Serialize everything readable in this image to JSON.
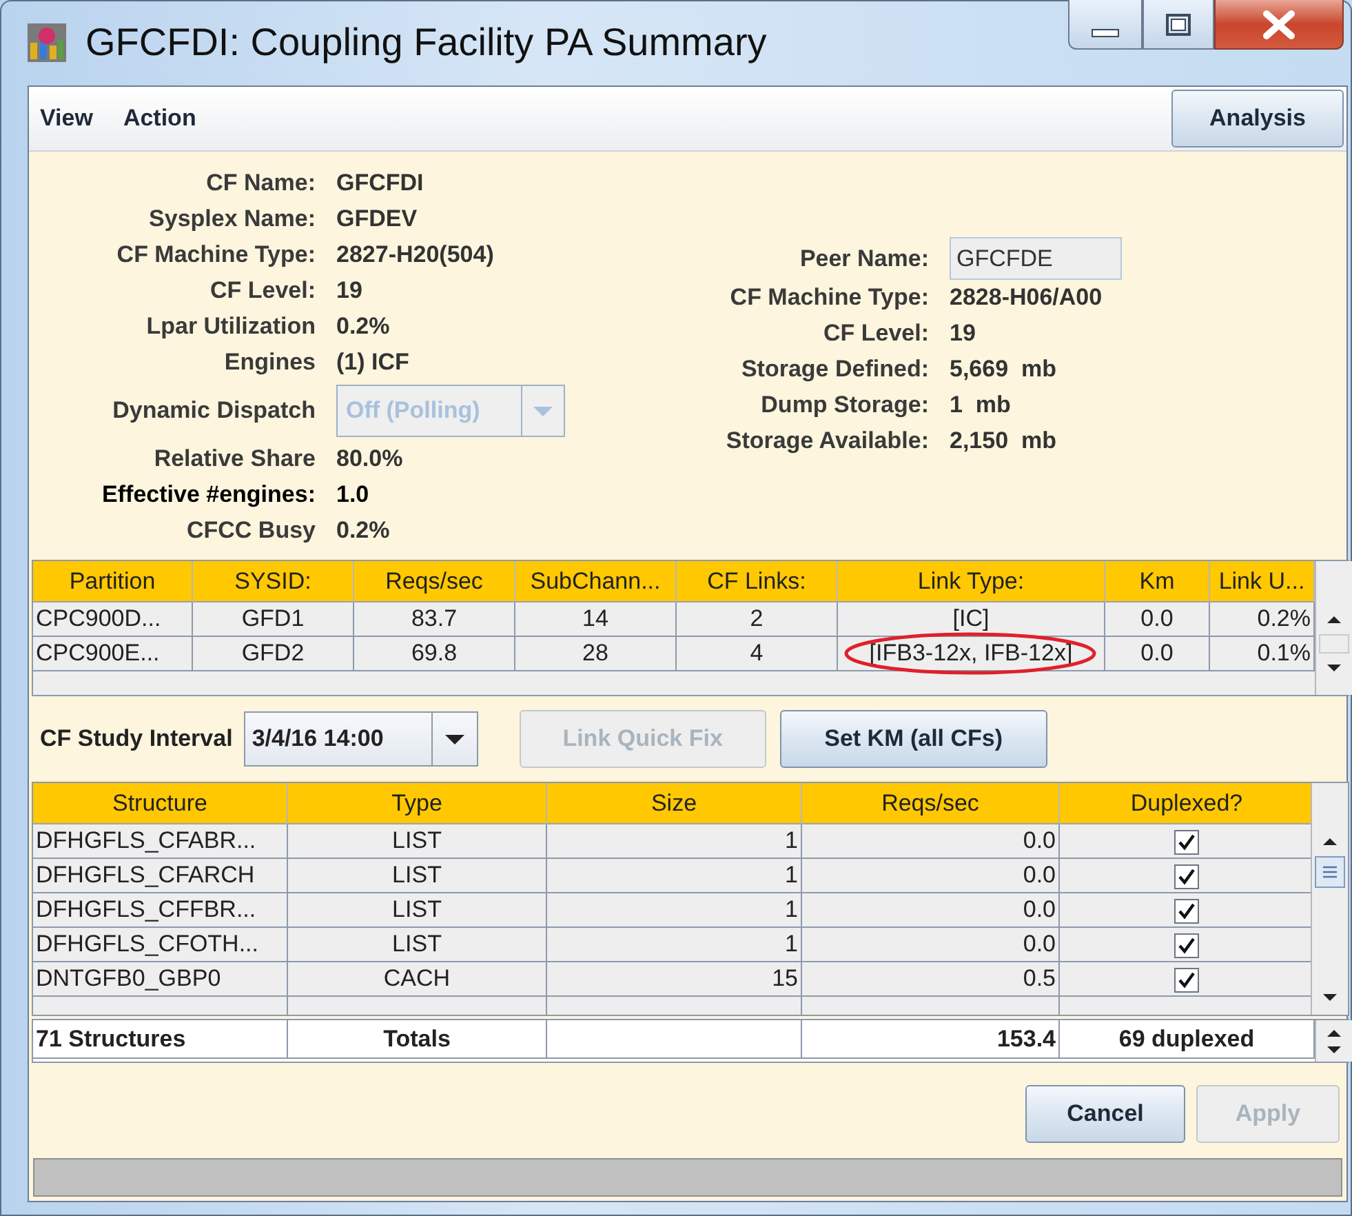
{
  "window": {
    "title": "GFCFDI: Coupling Facility PA Summary"
  },
  "menu": [
    {
      "label": "View"
    },
    {
      "label": "Action"
    }
  ],
  "toolbar_button": {
    "label": "Analysis"
  },
  "cf_info": [
    {
      "kind": "text",
      "label": "CF Name:",
      "value": "GFCFDI",
      "emphasized": false
    },
    {
      "kind": "text",
      "label": "Sysplex Name:",
      "value": "GFDEV",
      "emphasized": false
    },
    {
      "kind": "text",
      "label": "CF Machine Type:",
      "value": "2827-H20(504)",
      "emphasized": false
    },
    {
      "kind": "text",
      "label": "CF Level:",
      "value": "19",
      "emphasized": false
    },
    {
      "kind": "text",
      "label": "Lpar Utilization",
      "value": "0.2%",
      "emphasized": false
    },
    {
      "kind": "text",
      "label": "Engines",
      "value": "(1) ICF",
      "emphasized": false
    },
    {
      "kind": "combo",
      "label": "Dynamic Dispatch",
      "value": "Off (Polling)",
      "disabled": true,
      "emphasized": false
    },
    {
      "kind": "text",
      "label": "Relative Share",
      "value": "80.0%",
      "emphasized": false
    },
    {
      "kind": "text",
      "label": "Effective #engines:",
      "value": "1.0",
      "emphasized": true
    },
    {
      "kind": "text",
      "label": "CFCC Busy",
      "value": "0.2%",
      "emphasized": false
    }
  ],
  "peer_info": [
    {
      "kind": "field",
      "label": "Peer Name:",
      "value": "GFCFDE"
    },
    {
      "kind": "text",
      "label": "CF Machine Type:",
      "value": "2828-H06/A00"
    },
    {
      "kind": "text",
      "label": "CF Level:",
      "value": "19"
    },
    {
      "kind": "text",
      "label": "Storage Defined:",
      "value": "5,669  mb"
    },
    {
      "kind": "text",
      "label": "Dump Storage:",
      "value": "1  mb"
    },
    {
      "kind": "text",
      "label": "Storage Available:",
      "value": "2,150  mb"
    }
  ],
  "partitions_table": {
    "columns": [
      "Partition",
      "SYSID:",
      "Reqs/sec",
      "SubChann...",
      "CF Links:",
      "Link Type:",
      "Km",
      "Link U..."
    ],
    "rows": [
      {
        "cells": [
          "CPC900D...",
          "GFD1",
          "83.7",
          "14",
          "2",
          "[IC]",
          "0.0",
          "0.2%"
        ],
        "link_type_circled": false
      },
      {
        "cells": [
          "CPC900E...",
          "GFD2",
          "69.8",
          "28",
          "4",
          "[IFB3-12x, IFB-12x]",
          "0.0",
          "0.1%"
        ],
        "link_type_circled": true
      }
    ]
  },
  "study_interval": {
    "label": "CF Study Interval",
    "value": "3/4/16 14:00"
  },
  "action_buttons": [
    {
      "label": "Link Quick Fix",
      "disabled": true
    },
    {
      "label": "Set KM (all CFs)",
      "disabled": false
    }
  ],
  "structures_table": {
    "columns": [
      "Structure",
      "Type",
      "Size",
      "Reqs/sec",
      "Duplexed?"
    ],
    "rows": [
      {
        "cells": [
          "DFHGFLS_CFABR...",
          "LIST",
          "1",
          "0.0"
        ],
        "duplexed": true
      },
      {
        "cells": [
          "DFHGFLS_CFARCH",
          "LIST",
          "1",
          "0.0"
        ],
        "duplexed": true
      },
      {
        "cells": [
          "DFHGFLS_CFFBR...",
          "LIST",
          "1",
          "0.0"
        ],
        "duplexed": true
      },
      {
        "cells": [
          "DFHGFLS_CFOTH...",
          "LIST",
          "1",
          "0.0"
        ],
        "duplexed": true
      },
      {
        "cells": [
          "DNTGFB0_GBP0",
          "CACH",
          "15",
          "0.5"
        ],
        "duplexed": true
      }
    ],
    "totals": {
      "count": "71 Structures",
      "label": "Totals",
      "reqs": "153.4",
      "duplexed": "69 duplexed"
    }
  },
  "dialog_buttons": [
    {
      "label": "Cancel",
      "disabled": false
    },
    {
      "label": "Apply",
      "disabled": true
    }
  ]
}
